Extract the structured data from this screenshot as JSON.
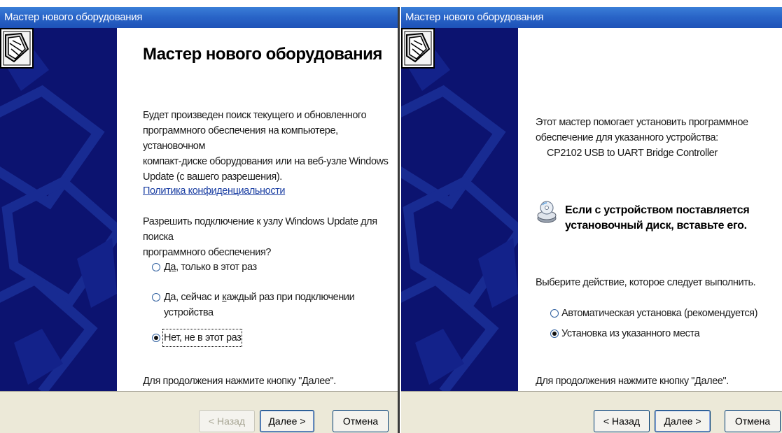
{
  "left_wizard": {
    "title": "Мастер нового оборудования",
    "heading": "Мастер нового оборудования",
    "intro_lines": [
      "Будет произведен поиск текущего и обновленного",
      "программного обеспечения на компьютере, установочном",
      "компакт-диске оборудования или на веб-узле Windows",
      "Update (с вашего разрешения)."
    ],
    "privacy_link": "Политика конфиденциальности",
    "question_lines": [
      "Разрешить подключение к узлу Windows Update для поиска",
      "программного обеспечения?"
    ],
    "options": [
      {
        "prefix": "Да",
        "suffix": ", только в этот раз",
        "selected": false
      },
      {
        "prefix": "Да, сейчас и ",
        "accel": "к",
        "rest": "аждый раз при подключении",
        "line2": "устройства",
        "selected": false
      },
      {
        "prefix": "Нет",
        "suffix": ", не в этот раз",
        "selected": true
      }
    ],
    "continue_text": "Для продолжения нажмите кнопку \"Далее\".",
    "back_label": "< Назад",
    "next_label": "Далее >",
    "cancel_label": "Отмена"
  },
  "right_wizard": {
    "title": "Мастер нового оборудования",
    "intro_lines": [
      "Этот мастер помогает установить программное",
      "обеспечение для указанного устройства:"
    ],
    "device_name": "CP2102 USB to UART Bridge Controller",
    "disk_message_lines": [
      "Если с устройством поставляется",
      "установочный диск, вставьте его."
    ],
    "choose_action": "Выберите действие, которое следует выполнить.",
    "options": [
      {
        "label": "Автоматическая установка (рекомендуется)",
        "selected": false
      },
      {
        "label": "Установка из указанного места",
        "selected": true
      }
    ],
    "continue_text": "Для продолжения нажмите кнопку \"Далее\".",
    "back_label": "< Назад",
    "next_label": "Далее >",
    "cancel_label": "Отмена"
  },
  "colors": {
    "titlebar": "#2a65c8",
    "banner": "#0c1370",
    "footer": "#ece9d8",
    "link": "#1b3fa3"
  },
  "icons": [
    "hardware-wizard-icon",
    "cd-disk-icon"
  ]
}
